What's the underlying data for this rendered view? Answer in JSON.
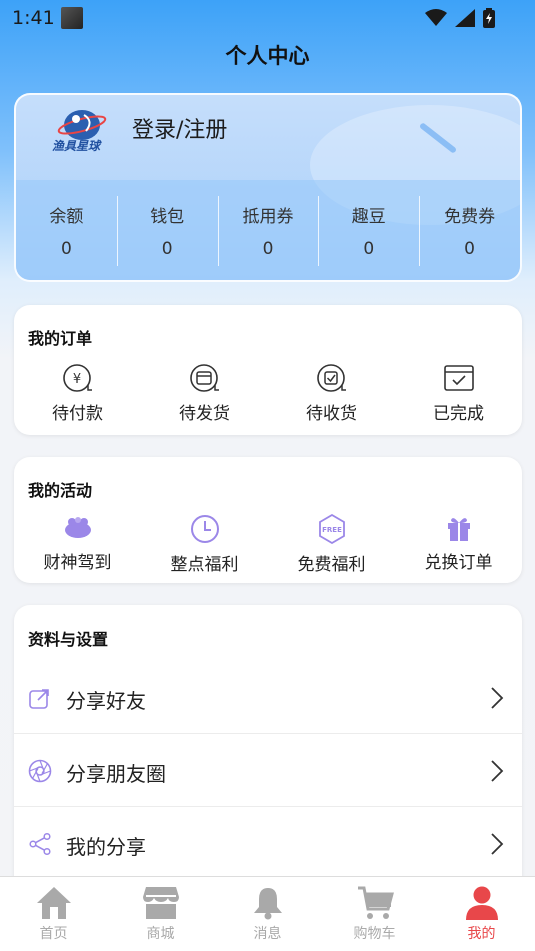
{
  "status_bar": {
    "time": "1:41"
  },
  "page_title": "个人中心",
  "profile": {
    "logo_text": "渔具星球",
    "login_label": "登录/注册",
    "stats": [
      {
        "label": "余额",
        "value": "0"
      },
      {
        "label": "钱包",
        "value": "0"
      },
      {
        "label": "抵用券",
        "value": "0"
      },
      {
        "label": "趣豆",
        "value": "0"
      },
      {
        "label": "免费券",
        "value": "0"
      }
    ]
  },
  "orders": {
    "title": "我的订单",
    "items": [
      {
        "label": "待付款",
        "icon": "yen-icon"
      },
      {
        "label": "待发货",
        "icon": "box-icon"
      },
      {
        "label": "待收货",
        "icon": "receive-icon"
      },
      {
        "label": "已完成",
        "icon": "done-icon"
      }
    ]
  },
  "activities": {
    "title": "我的活动",
    "items": [
      {
        "label": "财神驾到",
        "icon": "fortune-icon"
      },
      {
        "label": "整点福利",
        "icon": "clock-icon"
      },
      {
        "label": "免费福利",
        "icon": "free-badge-icon",
        "badge_text": "FREE"
      },
      {
        "label": "兑换订单",
        "icon": "gift-icon"
      }
    ]
  },
  "settings": {
    "title": "资料与设置",
    "items": [
      {
        "label": "分享好友",
        "icon": "share-out-icon"
      },
      {
        "label": "分享朋友圈",
        "icon": "aperture-icon"
      },
      {
        "label": "我的分享",
        "icon": "share-nodes-icon"
      }
    ]
  },
  "tabbar": {
    "items": [
      {
        "label": "首页",
        "icon": "home-icon",
        "active": false
      },
      {
        "label": "商城",
        "icon": "store-icon",
        "active": false
      },
      {
        "label": "消息",
        "icon": "bell-icon",
        "active": false
      },
      {
        "label": "购物车",
        "icon": "cart-icon",
        "active": false
      },
      {
        "label": "我的",
        "icon": "user-icon",
        "active": true
      }
    ]
  },
  "colors": {
    "accent": "#9b87e8",
    "active_tab": "#e8474a",
    "inactive_tab": "#a9a9a9",
    "header_blue": "#3da2f8"
  }
}
